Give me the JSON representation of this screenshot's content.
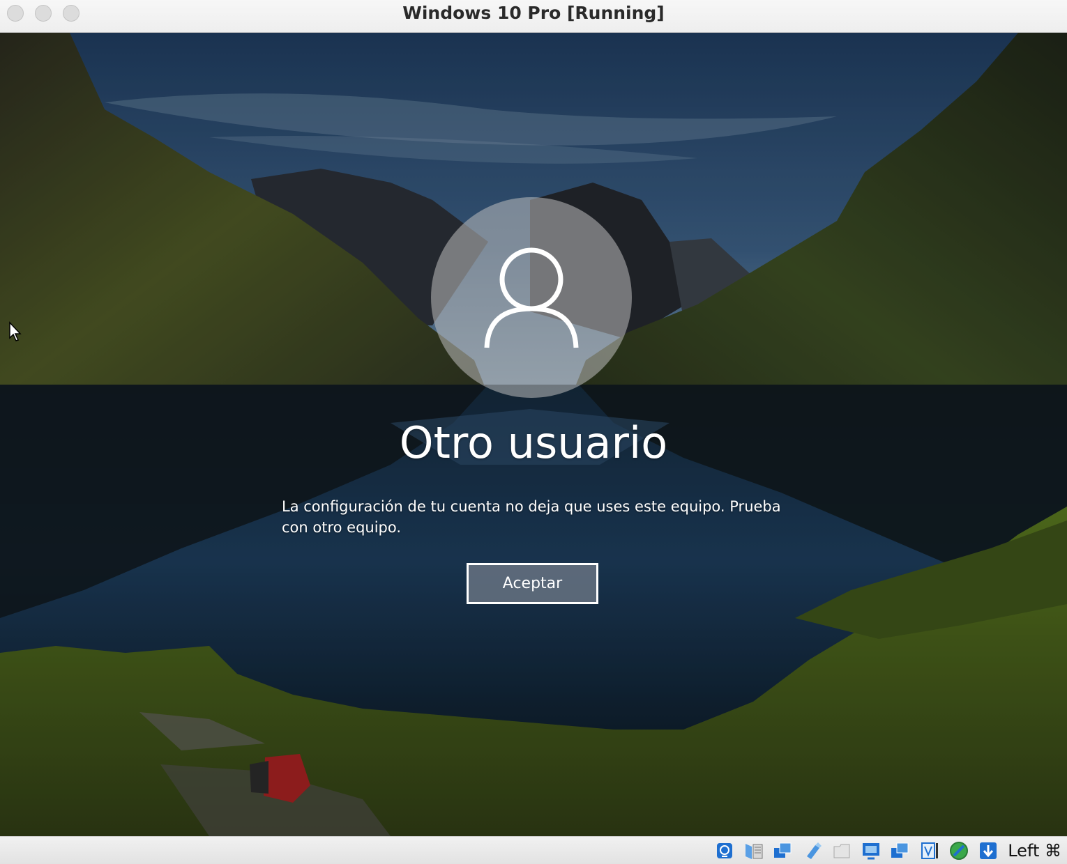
{
  "window": {
    "title": "Windows 10 Pro [Running]"
  },
  "lock_screen": {
    "username": "Otro usuario",
    "message": "La configuración de tu cuenta no deja que uses este equipo. Prueba con otro equipo.",
    "accept_label": "Aceptar"
  },
  "status_bar": {
    "icons": [
      "hard-disk-icon",
      "optical-drive-icon",
      "network-icon",
      "usb-icon",
      "shared-folders-icon",
      "display-icon",
      "video-capture-icon",
      "recording-icon",
      "mouse-integration-icon",
      "keyboard-capture-icon"
    ],
    "host_key": "Left ⌘"
  },
  "colors": {
    "sky": "#2e4a6b",
    "lake": "#10263c",
    "grass": "#4d6a1f",
    "button_border": "#ffffff"
  }
}
